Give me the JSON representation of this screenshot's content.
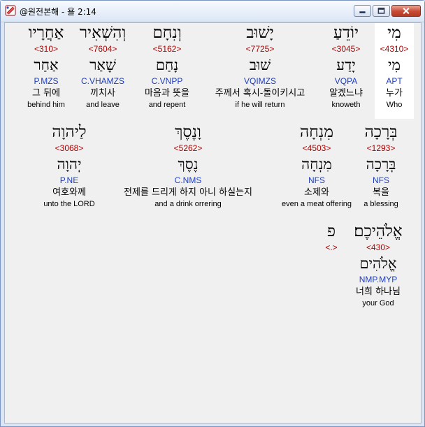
{
  "window": {
    "title": "@원전본해 - 욜 2:14",
    "icon": "bible-app-icon"
  },
  "controls": {
    "minimize": "minimize-icon",
    "maximize": "maximize-icon",
    "close": "close-icon"
  },
  "words": [
    {
      "hebrew": "מִי",
      "strong": "<4310>",
      "root": "מִי",
      "morph": "APT",
      "korean": "누가",
      "english": "Who"
    },
    {
      "hebrew": "יוֹדֵעַ",
      "strong": "<3045>",
      "root": "יָדַע",
      "morph": "VQPA",
      "korean": "알겠느냐",
      "english": "knoweth"
    },
    {
      "hebrew": "יָשׁוּב",
      "strong": "<7725>",
      "root": "שׁוּב",
      "morph": "VQIMZS",
      "korean": "주께서 혹시-돌이키시고",
      "english": "if he will return"
    },
    {
      "hebrew": "וְנִחָם",
      "strong": "<5162>",
      "root": "נָחַם",
      "morph": "C.VNPP",
      "korean": "마음과 뜻을",
      "english": "and repent"
    },
    {
      "hebrew": "וְהִשְׁאִיר",
      "strong": "<7604>",
      "root": "שָׁאַר",
      "morph": "C.VHAMZS",
      "korean": "끼치사",
      "english": "and leave"
    },
    {
      "hebrew": "אַחֲרָיו",
      "strong": "<310>",
      "root": "אַחַר",
      "morph": "P.MZS",
      "korean": "그 뒤에",
      "english": "behind him"
    },
    {
      "hebrew": "בְּרָכָה",
      "strong": "<1293>",
      "root": "בְּרָכָה",
      "morph": "NFS",
      "korean": "복을",
      "english": "a blessing"
    },
    {
      "hebrew": "מִנְחָה",
      "strong": "<4503>",
      "root": "מִנְחָה",
      "morph": "NFS",
      "korean": "소제와",
      "english": "even a meat offering"
    },
    {
      "hebrew": "וָנֶסֶךְ",
      "strong": "<5262>",
      "root": "נֶסֶךְ",
      "morph": "C.NMS",
      "korean": "전제를 드리게 하지 아니 하실는지",
      "english": "and a drink orrering"
    },
    {
      "hebrew": "לַיהוָה",
      "strong": "<3068>",
      "root": "יְהוָה",
      "morph": "P.NE",
      "korean": "여호와께",
      "english": "unto the LORD"
    },
    {
      "hebrew": "אֱלֹהֵיכֶם׃",
      "strong": "<430>",
      "root": "אֱלֹהִים",
      "morph": "NMP.MYP",
      "korean": "너희 하나님",
      "english": "your God"
    },
    {
      "hebrew": "פ",
      "strong": "<.>"
    }
  ]
}
